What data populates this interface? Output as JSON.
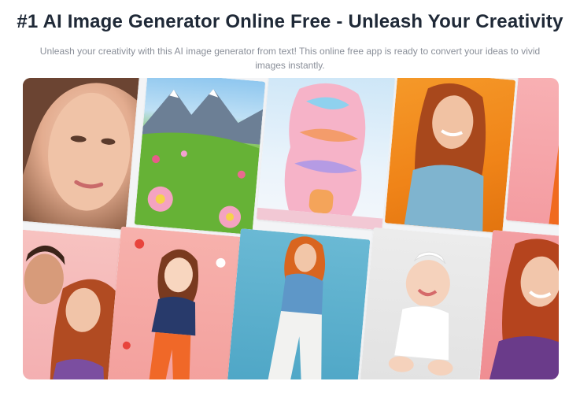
{
  "header": {
    "title": "#1 AI Image Generator Online Free - Unleash Your Creativity",
    "subtitle": "Unleash your creativity with this AI image generator from text! This online free app is ready to convert your ideas to vivid images instantly."
  },
  "gallery": {
    "images": [
      {
        "name": "woman-portrait-closeup",
        "accent": "#e7b79a"
      },
      {
        "name": "mountain-flower-meadow",
        "accent": "#6fbf3f"
      },
      {
        "name": "pastel-wavy-building",
        "accent": "#f3a7c9"
      },
      {
        "name": "redhead-woman-orange-background",
        "accent": "#f08a1c"
      },
      {
        "name": "pink-panel-edge",
        "accent": "#f6a3a8"
      },
      {
        "name": "couple-romantic",
        "accent": "#f5b5b3"
      },
      {
        "name": "anime-girl-flowers",
        "accent": "#f4a8a6"
      },
      {
        "name": "redhead-woman-blue-background",
        "accent": "#64b3cf"
      },
      {
        "name": "smiling-baby-bow",
        "accent": "#e8e8e8"
      },
      {
        "name": "redhead-woman-purple-shirt",
        "accent": "#f09a9c"
      }
    ]
  }
}
